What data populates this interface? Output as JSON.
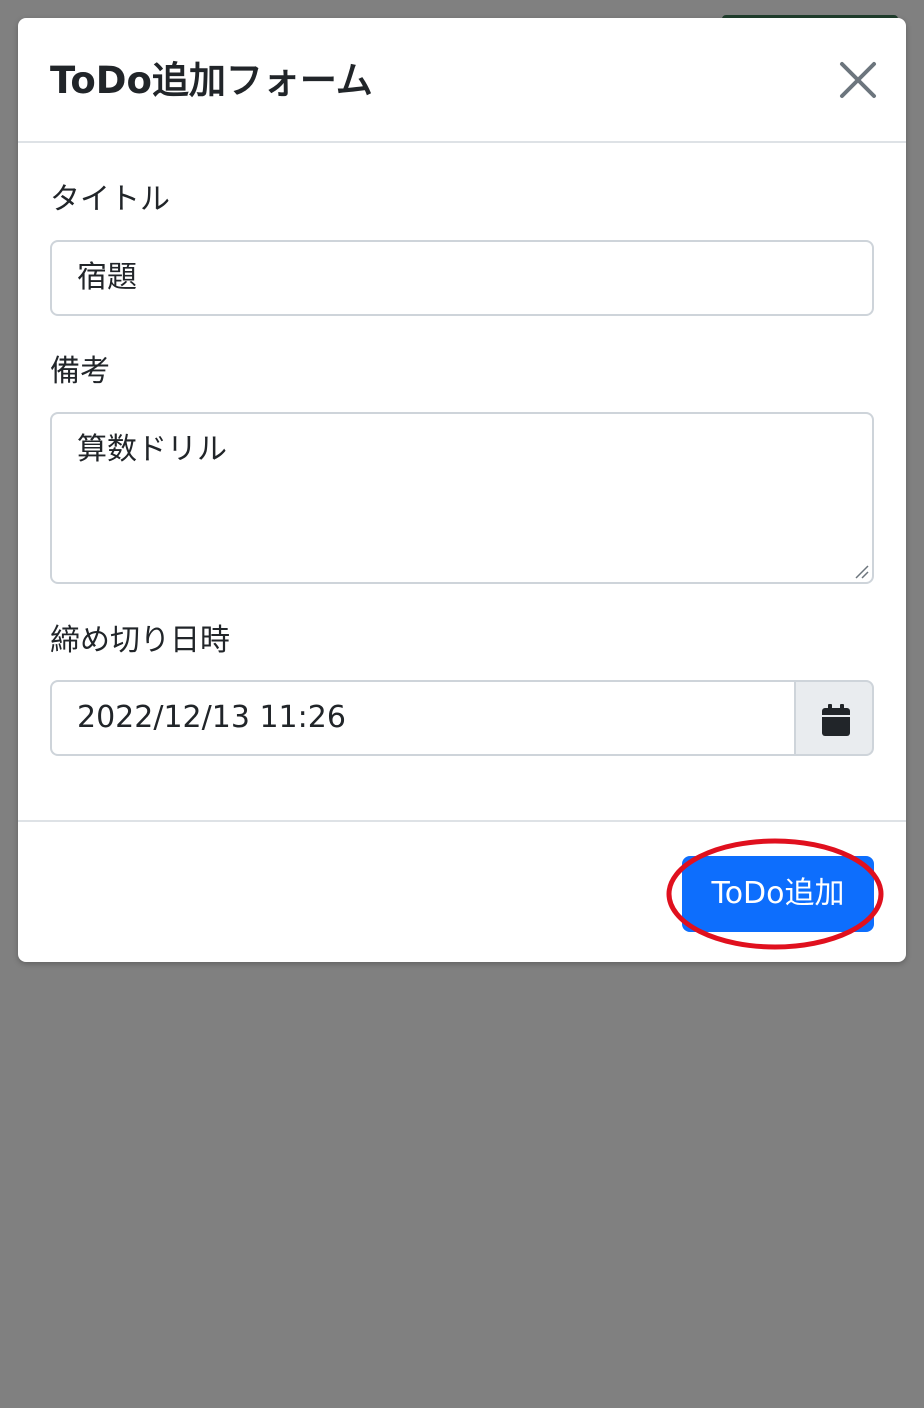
{
  "modal": {
    "title": "ToDo追加フォーム",
    "close_icon": "close-icon"
  },
  "form": {
    "title": {
      "label": "タイトル",
      "value": "宿題"
    },
    "note": {
      "label": "備考",
      "value": "算数ドリル"
    },
    "deadline": {
      "label": "締め切り日時",
      "value": "2022/12/13 11:26",
      "icon": "calendar-icon"
    }
  },
  "footer": {
    "submit_label": "ToDo追加"
  },
  "colors": {
    "backdrop": "#808080",
    "primary": "#0d6efd",
    "annotation": "#e0101e",
    "input_border": "#ced4da",
    "addon_background": "#e9ecef"
  }
}
